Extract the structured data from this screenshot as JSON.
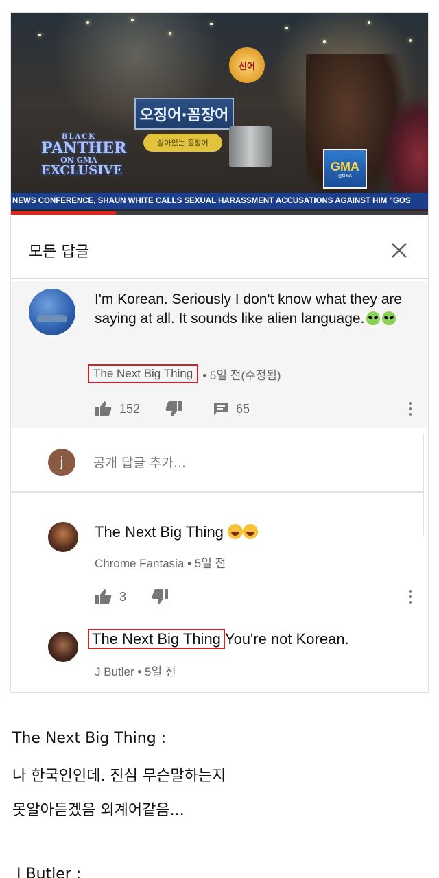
{
  "video": {
    "ticker": "NEWS CONFERENCE, SHAUN WHITE CALLS SEXUAL HARASSMENT ACCUSATIONS AGAINST HIM \"GOS",
    "sign_blue": "오징어·꼼장어",
    "sign_yellow": "살아있는 꼼장어",
    "lantern": "선어",
    "logo": {
      "l1": "BLACK",
      "l2": "PANTHER",
      "l3": "ON GMA",
      "l4": "EXCLUSIVE"
    },
    "badge": {
      "main": "GMA",
      "sub": "@GMA"
    },
    "progress": 0.25
  },
  "replies": {
    "title": "모든 답글",
    "close_icon": "close-icon"
  },
  "main_comment": {
    "text": "I'm Korean. Seriously I don't know what they are saying at all.  It sounds like alien language.",
    "author": "The Next Big Thing",
    "time": "• 5일 전(수정됨)",
    "likes": "152",
    "replies_count": "65"
  },
  "add_reply": {
    "avatar_letter": "j",
    "placeholder": "공개 답글 추가..."
  },
  "reply1": {
    "title": "The Next Big Thing",
    "author": "Chrome Fantasia",
    "time": "• 5일 전",
    "likes": "3"
  },
  "reply2": {
    "mention": "The Next Big Thing",
    "text": "You're not Korean.",
    "author": "J Butler",
    "time": "• 5일 전"
  },
  "caption": {
    "line1": "The Next Big Thing :",
    "line2": "나 한국인인데. 진심 무슨말하는지",
    "line3": "못알아듣겠음 외계어같음...",
    "line4": "J Butler :"
  },
  "colors": {
    "ticker_bg": "#1b3f8a",
    "progress": "#e62117",
    "highlight_box": "#d0202a"
  }
}
